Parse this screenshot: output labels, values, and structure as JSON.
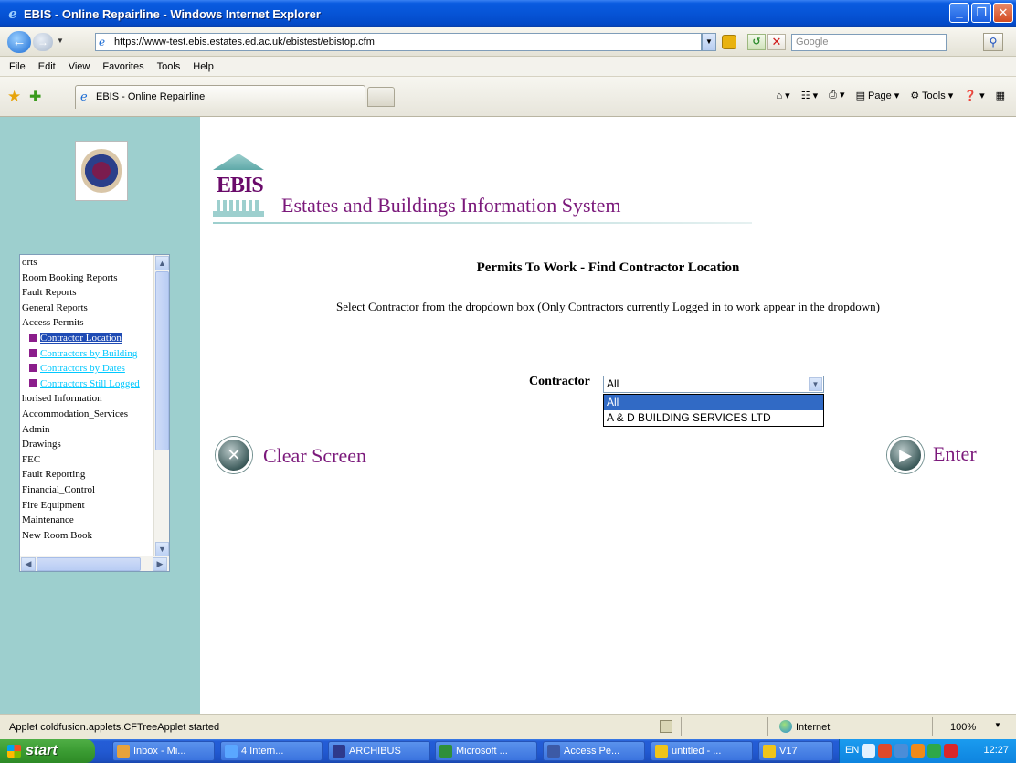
{
  "window": {
    "title": "EBIS - Online Repairline - Windows Internet Explorer",
    "controls": [
      "_",
      "❐",
      "✕"
    ]
  },
  "address_bar": {
    "url": "https://www-test.ebis.estates.ed.ac.uk/ebistest/ebistop.cfm",
    "search_placeholder": "Google"
  },
  "menu": [
    "File",
    "Edit",
    "View",
    "Favorites",
    "Tools",
    "Help"
  ],
  "tab": {
    "title": "EBIS - Online Repairline"
  },
  "command_bar": {
    "page_label": "Page",
    "tools_label": "Tools"
  },
  "header": {
    "logo_text": "EBIS",
    "title": "Estates and Buildings Information System"
  },
  "tree": {
    "items": [
      {
        "label": "orts",
        "type": "folder"
      },
      {
        "label": "Room Booking Reports",
        "type": "folder"
      },
      {
        "label": "Fault Reports",
        "type": "folder"
      },
      {
        "label": "General Reports",
        "type": "folder"
      },
      {
        "label": "Access Permits",
        "type": "folder"
      },
      {
        "label": "Contractor Location",
        "type": "link",
        "selected": true
      },
      {
        "label": "Contractors by Building",
        "type": "link"
      },
      {
        "label": "Contractors by Dates",
        "type": "link"
      },
      {
        "label": "Contractors Still Logged",
        "type": "link"
      },
      {
        "label": "horised Information",
        "type": "folder"
      },
      {
        "label": "Accommodation_Services",
        "type": "folder"
      },
      {
        "label": "Admin",
        "type": "folder"
      },
      {
        "label": "Drawings",
        "type": "folder"
      },
      {
        "label": "FEC",
        "type": "folder"
      },
      {
        "label": "Fault Reporting",
        "type": "folder"
      },
      {
        "label": "Financial_Control",
        "type": "folder"
      },
      {
        "label": "Fire Equipment",
        "type": "folder"
      },
      {
        "label": "Maintenance",
        "type": "folder"
      },
      {
        "label": "New Room Book",
        "type": "folder"
      }
    ]
  },
  "main": {
    "heading": "Permits To Work - Find Contractor Location",
    "instructions": "Select Contractor from the dropdown box (Only Contractors currently Logged in to work appear in the dropdown)",
    "contractor_label": "Contractor",
    "contractor_selected": "All",
    "contractor_options": [
      "All",
      "A & D BUILDING SERVICES LTD"
    ],
    "clear_label": "Clear Screen",
    "enter_label": "Enter"
  },
  "status_bar": {
    "text": "Applet coldfusion.applets.CFTreeApplet started",
    "zone": "Internet",
    "zoom": "100%"
  },
  "taskbar": {
    "start_label": "start",
    "buttons": [
      {
        "label": "Inbox - Mi...",
        "icon_color": "#e8a23c"
      },
      {
        "label": "4 Intern...",
        "icon_color": "#5aa7ff"
      },
      {
        "label": "ARCHIBUS",
        "icon_color": "#2e3a8c"
      },
      {
        "label": "Microsoft ...",
        "icon_color": "#2f8f3a"
      },
      {
        "label": "Access Pe...",
        "icon_color": "#3c5aa6"
      },
      {
        "label": "untitled - ...",
        "icon_color": "#f0c419"
      },
      {
        "label": "V17",
        "icon_color": "#f0c419"
      }
    ],
    "tray_lang": "EN",
    "clock": "12:27"
  }
}
